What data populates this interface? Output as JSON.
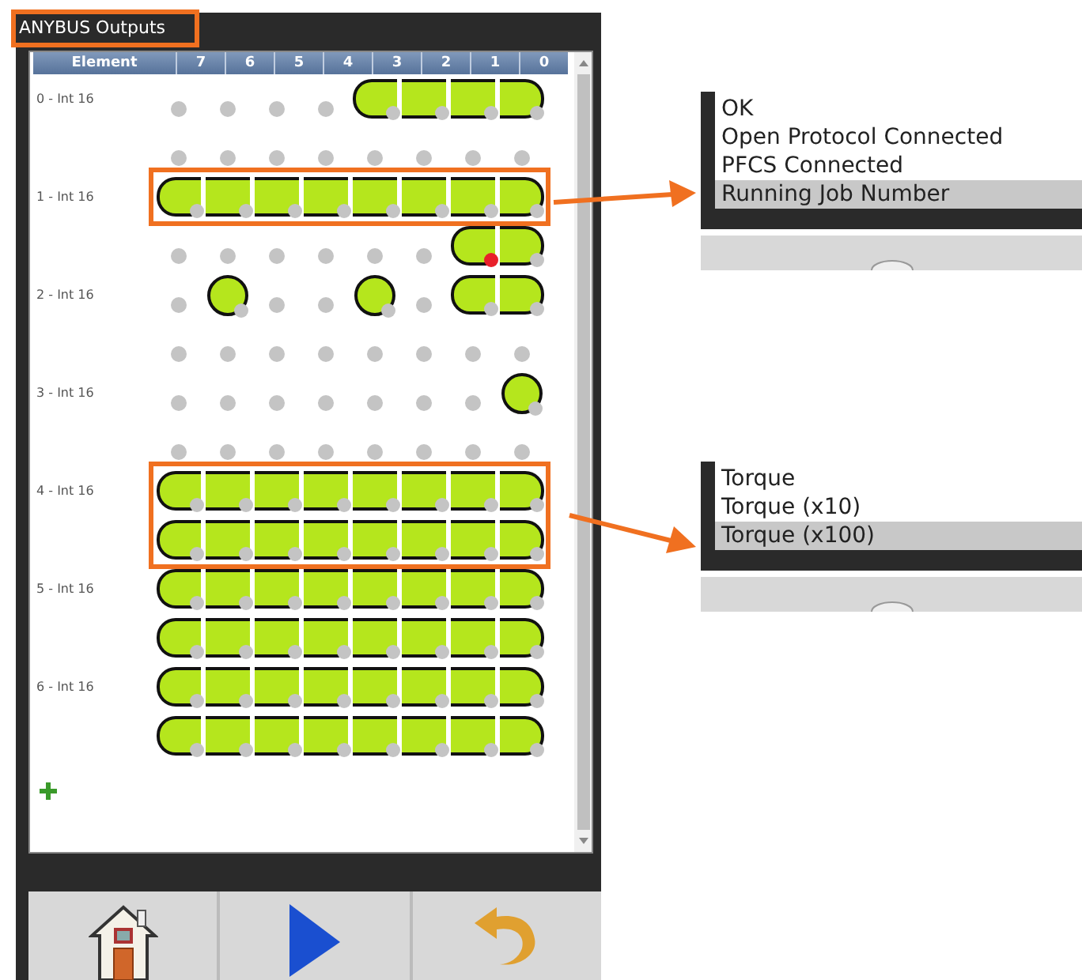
{
  "panel": {
    "title": "ANYBUS Outputs",
    "columns": [
      "Element",
      "7",
      "6",
      "5",
      "4",
      "3",
      "2",
      "1",
      "0"
    ],
    "elements": [
      {
        "label": "0 - Int 16",
        "lines": [
          {
            "highlighted": false,
            "bits": [
              {
                "on": false,
                "alert": false
              },
              {
                "on": false,
                "alert": false
              },
              {
                "on": false,
                "alert": false
              },
              {
                "on": false,
                "alert": false
              },
              {
                "on": true,
                "alert": false
              },
              {
                "on": true,
                "alert": false
              },
              {
                "on": true,
                "alert": false
              },
              {
                "on": true,
                "alert": false
              }
            ]
          },
          {
            "highlighted": false,
            "bits": [
              {
                "on": false,
                "alert": false
              },
              {
                "on": false,
                "alert": false
              },
              {
                "on": false,
                "alert": false
              },
              {
                "on": false,
                "alert": false
              },
              {
                "on": false,
                "alert": false
              },
              {
                "on": false,
                "alert": false
              },
              {
                "on": false,
                "alert": false
              },
              {
                "on": false,
                "alert": false
              }
            ]
          }
        ]
      },
      {
        "label": "1 - Int 16",
        "lines": [
          {
            "highlighted": true,
            "bits": [
              {
                "on": true,
                "alert": false
              },
              {
                "on": true,
                "alert": false
              },
              {
                "on": true,
                "alert": false
              },
              {
                "on": true,
                "alert": false
              },
              {
                "on": true,
                "alert": false
              },
              {
                "on": true,
                "alert": false
              },
              {
                "on": true,
                "alert": false
              },
              {
                "on": true,
                "alert": false
              }
            ]
          },
          {
            "highlighted": false,
            "bits": [
              {
                "on": false,
                "alert": false
              },
              {
                "on": false,
                "alert": false
              },
              {
                "on": false,
                "alert": false
              },
              {
                "on": false,
                "alert": false
              },
              {
                "on": false,
                "alert": false
              },
              {
                "on": false,
                "alert": false
              },
              {
                "on": true,
                "alert": true
              },
              {
                "on": true,
                "alert": false
              }
            ]
          }
        ]
      },
      {
        "label": "2 - Int 16",
        "lines": [
          {
            "highlighted": false,
            "bits": [
              {
                "on": false,
                "alert": false
              },
              {
                "on": true,
                "alert": false
              },
              {
                "on": false,
                "alert": false
              },
              {
                "on": false,
                "alert": false
              },
              {
                "on": true,
                "alert": false
              },
              {
                "on": false,
                "alert": false
              },
              {
                "on": true,
                "alert": false
              },
              {
                "on": true,
                "alert": false
              }
            ]
          },
          {
            "highlighted": false,
            "bits": [
              {
                "on": false,
                "alert": false
              },
              {
                "on": false,
                "alert": false
              },
              {
                "on": false,
                "alert": false
              },
              {
                "on": false,
                "alert": false
              },
              {
                "on": false,
                "alert": false
              },
              {
                "on": false,
                "alert": false
              },
              {
                "on": false,
                "alert": false
              },
              {
                "on": false,
                "alert": false
              }
            ]
          }
        ]
      },
      {
        "label": "3 - Int 16",
        "lines": [
          {
            "highlighted": false,
            "bits": [
              {
                "on": false,
                "alert": false
              },
              {
                "on": false,
                "alert": false
              },
              {
                "on": false,
                "alert": false
              },
              {
                "on": false,
                "alert": false
              },
              {
                "on": false,
                "alert": false
              },
              {
                "on": false,
                "alert": false
              },
              {
                "on": false,
                "alert": false
              },
              {
                "on": true,
                "alert": false
              }
            ]
          },
          {
            "highlighted": false,
            "bits": [
              {
                "on": false,
                "alert": false
              },
              {
                "on": false,
                "alert": false
              },
              {
                "on": false,
                "alert": false
              },
              {
                "on": false,
                "alert": false
              },
              {
                "on": false,
                "alert": false
              },
              {
                "on": false,
                "alert": false
              },
              {
                "on": false,
                "alert": false
              },
              {
                "on": false,
                "alert": false
              }
            ]
          }
        ]
      },
      {
        "label": "4 - Int 16",
        "lines": [
          {
            "highlighted": true,
            "bits": [
              {
                "on": true,
                "alert": false
              },
              {
                "on": true,
                "alert": false
              },
              {
                "on": true,
                "alert": false
              },
              {
                "on": true,
                "alert": false
              },
              {
                "on": true,
                "alert": false
              },
              {
                "on": true,
                "alert": false
              },
              {
                "on": true,
                "alert": false
              },
              {
                "on": true,
                "alert": false
              }
            ]
          },
          {
            "highlighted": true,
            "bits": [
              {
                "on": true,
                "alert": false
              },
              {
                "on": true,
                "alert": false
              },
              {
                "on": true,
                "alert": false
              },
              {
                "on": true,
                "alert": false
              },
              {
                "on": true,
                "alert": false
              },
              {
                "on": true,
                "alert": false
              },
              {
                "on": true,
                "alert": false
              },
              {
                "on": true,
                "alert": false
              }
            ]
          }
        ]
      },
      {
        "label": "5 - Int 16",
        "lines": [
          {
            "highlighted": false,
            "bits": [
              {
                "on": true,
                "alert": false
              },
              {
                "on": true,
                "alert": false
              },
              {
                "on": true,
                "alert": false
              },
              {
                "on": true,
                "alert": false
              },
              {
                "on": true,
                "alert": false
              },
              {
                "on": true,
                "alert": false
              },
              {
                "on": true,
                "alert": false
              },
              {
                "on": true,
                "alert": false
              }
            ]
          },
          {
            "highlighted": false,
            "bits": [
              {
                "on": true,
                "alert": false
              },
              {
                "on": true,
                "alert": false
              },
              {
                "on": true,
                "alert": false
              },
              {
                "on": true,
                "alert": false
              },
              {
                "on": true,
                "alert": false
              },
              {
                "on": true,
                "alert": false
              },
              {
                "on": true,
                "alert": false
              },
              {
                "on": true,
                "alert": false
              }
            ]
          }
        ]
      },
      {
        "label": "6 - Int 16",
        "lines": [
          {
            "highlighted": false,
            "bits": [
              {
                "on": true,
                "alert": false
              },
              {
                "on": true,
                "alert": false
              },
              {
                "on": true,
                "alert": false
              },
              {
                "on": true,
                "alert": false
              },
              {
                "on": true,
                "alert": false
              },
              {
                "on": true,
                "alert": false
              },
              {
                "on": true,
                "alert": false
              },
              {
                "on": true,
                "alert": false
              }
            ]
          },
          {
            "highlighted": false,
            "bits": [
              {
                "on": true,
                "alert": false
              },
              {
                "on": true,
                "alert": false
              },
              {
                "on": true,
                "alert": false
              },
              {
                "on": true,
                "alert": false
              },
              {
                "on": true,
                "alert": false
              },
              {
                "on": true,
                "alert": false
              },
              {
                "on": true,
                "alert": false
              },
              {
                "on": true,
                "alert": false
              }
            ]
          }
        ]
      }
    ]
  },
  "toolbar": [
    {
      "kind": "home"
    },
    {
      "kind": "play"
    },
    {
      "kind": "undo"
    }
  ],
  "callouts": [
    {
      "items": [
        {
          "label": "OK",
          "selected": false
        },
        {
          "label": "Open Protocol Connected",
          "selected": false
        },
        {
          "label": "PFCS Connected",
          "selected": false
        },
        {
          "label": "Running Job Number",
          "selected": true
        }
      ]
    },
    {
      "items": [
        {
          "label": "Torque",
          "selected": false
        },
        {
          "label": "Torque (x10)",
          "selected": false
        },
        {
          "label": "Torque (x100)",
          "selected": true
        }
      ]
    }
  ]
}
